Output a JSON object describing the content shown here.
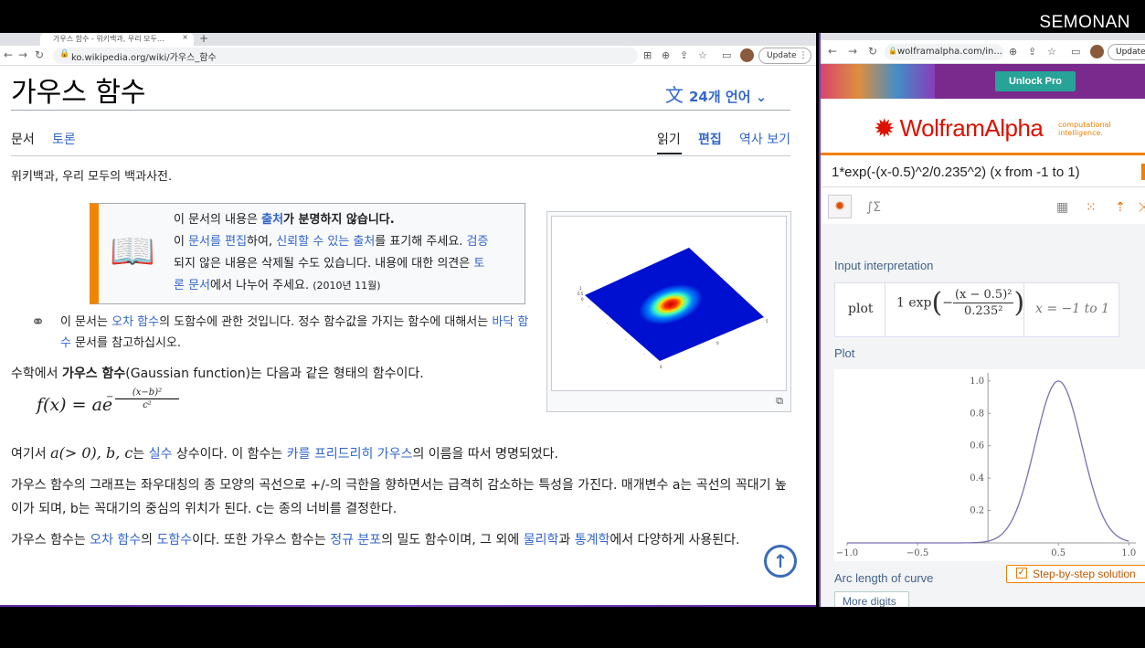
{
  "channel": "SEMONAN",
  "left_browser": {
    "tab_title": "가우스 함수 - 위키백과, 우리 모두…",
    "url": "ko.wikipedia.org/wiki/가우스_함수",
    "update_label": "Update"
  },
  "article": {
    "title": "가우스 함수",
    "languages": "24개 언어",
    "tabs": {
      "article": "문서",
      "talk": "토론",
      "read": "읽기",
      "edit": "편집",
      "history": "역사 보기"
    },
    "tagline": "위키백과, 우리 모두의 백과사전.",
    "ambox": {
      "l1a": "이 문서의 내용은 ",
      "l1link": "출처",
      "l1b": "가 분명하지 않습니다.",
      "l2a": "이 ",
      "l2link1": "문서를 편집",
      "l2b": "하여, ",
      "l2link2": "신뢰할 수 있는 출처",
      "l2c": "를 표기해 주세요. ",
      "l2link3": "검증",
      "l3a": "되지 않은 내용은 삭제될 수도 있습니다. 내용에 대한 의견은 ",
      "l3link": "토",
      "l4link": "론 문서",
      "l4a": "에서 나누어 주세요. ",
      "date": "(2010년 11월)"
    },
    "hatnote": {
      "a": "이 문서는 ",
      "link1": "오차 함수",
      "b": "의 도함수에 관한 것입니다. 정수 함수값을 가지는 함수에 대해서는 ",
      "link2": "바닥 함수",
      "c": " 문서를 참고하십시오."
    },
    "p1": {
      "a": "수학에서 ",
      "bold": "가우스 함수",
      "b": "(Gaussian function)는 다음과 같은 형태의 함수이다."
    },
    "formula": {
      "lhs": "f(x) = ae",
      "num": "(x−b)²",
      "den": "c²",
      "minus": "−"
    },
    "p2": {
      "math": "a(> 0), b, c",
      "a": "는 ",
      "link1": "실수",
      "b": " 상수이다. 이 함수는 ",
      "link2": "카를 프리드리히 가우스",
      "c": "의 이름을 따서 명명되었다.",
      "prefix": "여기서 "
    },
    "p3": "가우스 함수의 그래프는 좌우대칭의 종 모양의 곡선으로 +/-의 극한을 향하면서는 급격히 감소하는 특성을 가진다. 매개변수 a는 곡선의 꼭대기 높이가 되며, b는 꼭대기의 중심의 위치가 된다. c는 종의 너비를 결정한다.",
    "p4": {
      "a": "가우스 함수는 ",
      "link1": "오차 함수",
      "b": "의 ",
      "link2": "도함수",
      "c": "이다. 또한 가우스 함수는 ",
      "link3": "정규 분포",
      "d": "의 밀도 함수이며, 그 외에 ",
      "link4": "물리학",
      "e": "과 ",
      "link5": "통계학",
      "f": "에서 다양하게 사용된다."
    }
  },
  "right_browser": {
    "url": "wolframalpha.com/in...",
    "update_label": "Update"
  },
  "wolfram": {
    "unlock": "Unlock Pro",
    "logo": "WolframAlpha",
    "tagline": "computational intelligence.",
    "query": "1*exp(-(x-0.5)^2/0.235^2) (x from -1 to 1)",
    "input_interp_title": "Input interpretation",
    "interp": {
      "plot": "plot",
      "one_exp": "1 exp",
      "num": "(x − 0.5)²",
      "den": "0.235²",
      "range": "x = −1 to 1",
      "minus": "−"
    },
    "plot_title": "Plot",
    "arc_length": "Arc length of curve",
    "step_by_step": "Step-by-step solution",
    "more_digits": "More digits"
  },
  "chart_data": {
    "type": "line",
    "x_ticks": [
      "−1.0",
      "−0.5",
      "0.5",
      "1.0"
    ],
    "y_ticks": [
      "0.2",
      "0.4",
      "0.6",
      "0.8",
      "1.0"
    ],
    "xlim": [
      -1,
      1.05
    ],
    "ylim": [
      0,
      1.05
    ],
    "curve": {
      "amplitude": 1,
      "center": 0.5,
      "width": 0.235
    },
    "color": "#7a6fb0"
  }
}
